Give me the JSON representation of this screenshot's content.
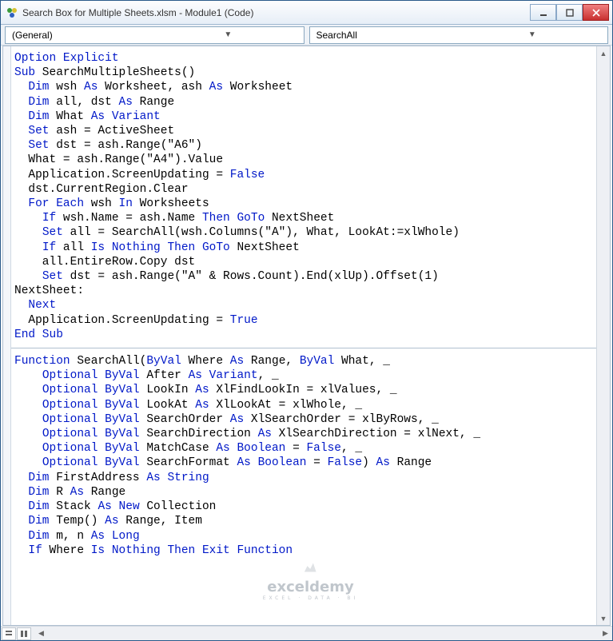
{
  "titlebar": {
    "title": "Search Box for Multiple Sheets.xlsm - Module1 (Code)"
  },
  "dropdowns": {
    "left": "(General)",
    "right": "SearchAll"
  },
  "code": [
    {
      "ind": 0,
      "t": [
        {
          "k": 1,
          "s": "Option Explicit"
        }
      ]
    },
    {
      "ind": 0,
      "t": [
        {
          "k": 1,
          "s": "Sub"
        },
        {
          "k": 0,
          "s": " SearchMultipleSheets()"
        }
      ]
    },
    {
      "ind": 1,
      "t": [
        {
          "k": 1,
          "s": "Dim"
        },
        {
          "k": 0,
          "s": " wsh "
        },
        {
          "k": 1,
          "s": "As"
        },
        {
          "k": 0,
          "s": " Worksheet, ash "
        },
        {
          "k": 1,
          "s": "As"
        },
        {
          "k": 0,
          "s": " Worksheet"
        }
      ]
    },
    {
      "ind": 1,
      "t": [
        {
          "k": 1,
          "s": "Dim"
        },
        {
          "k": 0,
          "s": " all, dst "
        },
        {
          "k": 1,
          "s": "As"
        },
        {
          "k": 0,
          "s": " Range"
        }
      ]
    },
    {
      "ind": 1,
      "t": [
        {
          "k": 1,
          "s": "Dim"
        },
        {
          "k": 0,
          "s": " What "
        },
        {
          "k": 1,
          "s": "As Variant"
        }
      ]
    },
    {
      "ind": 1,
      "t": [
        {
          "k": 1,
          "s": "Set"
        },
        {
          "k": 0,
          "s": " ash = ActiveSheet"
        }
      ]
    },
    {
      "ind": 1,
      "t": [
        {
          "k": 1,
          "s": "Set"
        },
        {
          "k": 0,
          "s": " dst = ash.Range(\"A6\")"
        }
      ]
    },
    {
      "ind": 1,
      "t": [
        {
          "k": 0,
          "s": "What = ash.Range(\"A4\").Value"
        }
      ]
    },
    {
      "ind": 1,
      "t": [
        {
          "k": 0,
          "s": "Application.ScreenUpdating = "
        },
        {
          "k": 1,
          "s": "False"
        }
      ]
    },
    {
      "ind": 1,
      "t": [
        {
          "k": 0,
          "s": "dst.CurrentRegion.Clear"
        }
      ]
    },
    {
      "ind": 1,
      "t": [
        {
          "k": 1,
          "s": "For Each"
        },
        {
          "k": 0,
          "s": " wsh "
        },
        {
          "k": 1,
          "s": "In"
        },
        {
          "k": 0,
          "s": " Worksheets"
        }
      ]
    },
    {
      "ind": 2,
      "t": [
        {
          "k": 1,
          "s": "If"
        },
        {
          "k": 0,
          "s": " wsh.Name = ash.Name "
        },
        {
          "k": 1,
          "s": "Then GoTo"
        },
        {
          "k": 0,
          "s": " NextSheet"
        }
      ]
    },
    {
      "ind": 2,
      "t": [
        {
          "k": 1,
          "s": "Set"
        },
        {
          "k": 0,
          "s": " all = SearchAll(wsh.Columns(\"A\"), What, LookAt:=xlWhole)"
        }
      ]
    },
    {
      "ind": 2,
      "t": [
        {
          "k": 1,
          "s": "If"
        },
        {
          "k": 0,
          "s": " all "
        },
        {
          "k": 1,
          "s": "Is Nothing Then GoTo"
        },
        {
          "k": 0,
          "s": " NextSheet"
        }
      ]
    },
    {
      "ind": 2,
      "t": [
        {
          "k": 0,
          "s": "all.EntireRow.Copy dst"
        }
      ]
    },
    {
      "ind": 2,
      "t": [
        {
          "k": 1,
          "s": "Set"
        },
        {
          "k": 0,
          "s": " dst = ash.Range(\"A\" & Rows.Count).End(xlUp).Offset(1)"
        }
      ]
    },
    {
      "ind": 0,
      "t": [
        {
          "k": 0,
          "s": "NextSheet:"
        }
      ]
    },
    {
      "ind": 1,
      "t": [
        {
          "k": 1,
          "s": "Next"
        }
      ]
    },
    {
      "ind": 1,
      "t": [
        {
          "k": 0,
          "s": "Application.ScreenUpdating = "
        },
        {
          "k": 1,
          "s": "True"
        }
      ]
    },
    {
      "ind": 0,
      "t": [
        {
          "k": 1,
          "s": "End Sub"
        }
      ]
    },
    {
      "hr": true
    },
    {
      "ind": 0,
      "t": [
        {
          "k": 1,
          "s": "Function"
        },
        {
          "k": 0,
          "s": " SearchAll("
        },
        {
          "k": 1,
          "s": "ByVal"
        },
        {
          "k": 0,
          "s": " Where "
        },
        {
          "k": 1,
          "s": "As"
        },
        {
          "k": 0,
          "s": " Range, "
        },
        {
          "k": 1,
          "s": "ByVal"
        },
        {
          "k": 0,
          "s": " What, _"
        }
      ]
    },
    {
      "ind": 2,
      "t": [
        {
          "k": 1,
          "s": "Optional ByVal"
        },
        {
          "k": 0,
          "s": " After "
        },
        {
          "k": 1,
          "s": "As Variant"
        },
        {
          "k": 0,
          "s": ", _"
        }
      ]
    },
    {
      "ind": 2,
      "t": [
        {
          "k": 1,
          "s": "Optional ByVal"
        },
        {
          "k": 0,
          "s": " LookIn "
        },
        {
          "k": 1,
          "s": "As"
        },
        {
          "k": 0,
          "s": " XlFindLookIn = xlValues, _"
        }
      ]
    },
    {
      "ind": 2,
      "t": [
        {
          "k": 1,
          "s": "Optional ByVal"
        },
        {
          "k": 0,
          "s": " LookAt "
        },
        {
          "k": 1,
          "s": "As"
        },
        {
          "k": 0,
          "s": " XlLookAt = xlWhole, _"
        }
      ]
    },
    {
      "ind": 2,
      "t": [
        {
          "k": 1,
          "s": "Optional ByVal"
        },
        {
          "k": 0,
          "s": " SearchOrder "
        },
        {
          "k": 1,
          "s": "As"
        },
        {
          "k": 0,
          "s": " XlSearchOrder = xlByRows, _"
        }
      ]
    },
    {
      "ind": 2,
      "t": [
        {
          "k": 1,
          "s": "Optional ByVal"
        },
        {
          "k": 0,
          "s": " SearchDirection "
        },
        {
          "k": 1,
          "s": "As"
        },
        {
          "k": 0,
          "s": " XlSearchDirection = xlNext, _"
        }
      ]
    },
    {
      "ind": 2,
      "t": [
        {
          "k": 1,
          "s": "Optional ByVal"
        },
        {
          "k": 0,
          "s": " MatchCase "
        },
        {
          "k": 1,
          "s": "As Boolean"
        },
        {
          "k": 0,
          "s": " = "
        },
        {
          "k": 1,
          "s": "False"
        },
        {
          "k": 0,
          "s": ", _"
        }
      ]
    },
    {
      "ind": 2,
      "t": [
        {
          "k": 1,
          "s": "Optional ByVal"
        },
        {
          "k": 0,
          "s": " SearchFormat "
        },
        {
          "k": 1,
          "s": "As Boolean"
        },
        {
          "k": 0,
          "s": " = "
        },
        {
          "k": 1,
          "s": "False"
        },
        {
          "k": 0,
          "s": ") "
        },
        {
          "k": 1,
          "s": "As"
        },
        {
          "k": 0,
          "s": " Range"
        }
      ]
    },
    {
      "ind": 1,
      "t": [
        {
          "k": 1,
          "s": "Dim"
        },
        {
          "k": 0,
          "s": " FirstAddress "
        },
        {
          "k": 1,
          "s": "As String"
        }
      ]
    },
    {
      "ind": 1,
      "t": [
        {
          "k": 1,
          "s": "Dim"
        },
        {
          "k": 0,
          "s": " R "
        },
        {
          "k": 1,
          "s": "As"
        },
        {
          "k": 0,
          "s": " Range"
        }
      ]
    },
    {
      "ind": 1,
      "t": [
        {
          "k": 1,
          "s": "Dim"
        },
        {
          "k": 0,
          "s": " Stack "
        },
        {
          "k": 1,
          "s": "As New"
        },
        {
          "k": 0,
          "s": " Collection"
        }
      ]
    },
    {
      "ind": 1,
      "t": [
        {
          "k": 1,
          "s": "Dim"
        },
        {
          "k": 0,
          "s": " Temp() "
        },
        {
          "k": 1,
          "s": "As"
        },
        {
          "k": 0,
          "s": " Range, Item"
        }
      ]
    },
    {
      "ind": 1,
      "t": [
        {
          "k": 1,
          "s": "Dim"
        },
        {
          "k": 0,
          "s": " m, n "
        },
        {
          "k": 1,
          "s": "As Long"
        }
      ]
    },
    {
      "ind": 1,
      "t": [
        {
          "k": 1,
          "s": "If"
        },
        {
          "k": 0,
          "s": " Where "
        },
        {
          "k": 1,
          "s": "Is Nothing Then Exit Function"
        }
      ]
    }
  ],
  "watermark": {
    "brand": "exceldemy",
    "tag": "EXCEL · DATA · BI"
  }
}
